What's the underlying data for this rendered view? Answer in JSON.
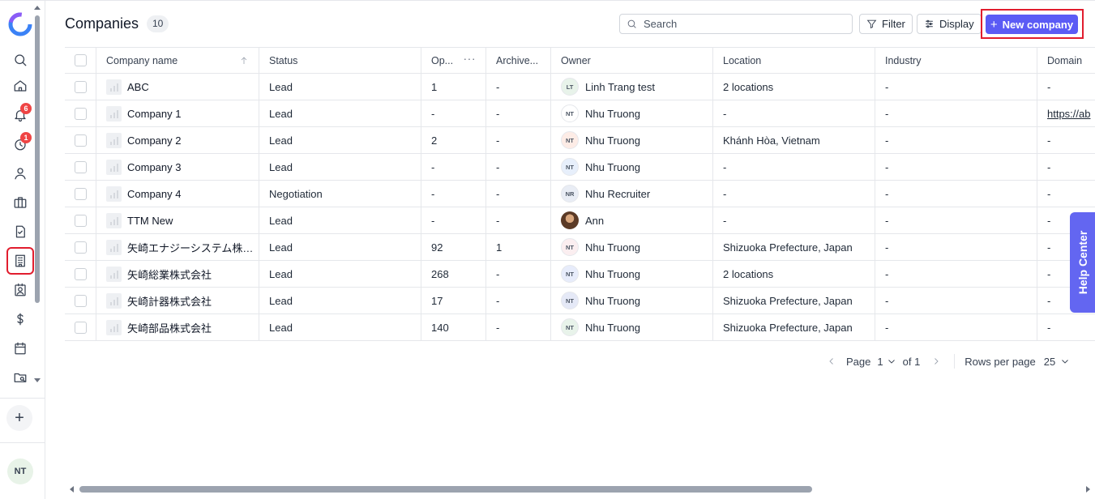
{
  "header": {
    "title": "Companies",
    "count": "10",
    "search_placeholder": "Search",
    "filter_label": "Filter",
    "display_label": "Display",
    "new_label": "New company"
  },
  "sidebar": {
    "badges": {
      "notifications": "6",
      "activity": "1"
    },
    "avatar": "NT",
    "icons": [
      "search-icon",
      "home-icon",
      "bell-icon",
      "activity-icon",
      "person-icon",
      "briefcase-icon",
      "task-icon",
      "building-icon",
      "contact-icon",
      "dollar-icon",
      "calendar-icon",
      "folder-search-icon",
      "plus-icon"
    ]
  },
  "table": {
    "columns": [
      "Company name",
      "Status",
      "Op...",
      "Archive...",
      "Owner",
      "Location",
      "Industry",
      "Domain"
    ],
    "rows": [
      {
        "name": "ABC",
        "status": "Lead",
        "opp": "1",
        "archived": "-",
        "owner_initials": "LT",
        "owner": "Linh Trang test",
        "location": "2 locations",
        "industry": "-",
        "domain": "-"
      },
      {
        "name": "Company 1",
        "status": "Lead",
        "opp": "-",
        "archived": "-",
        "owner_initials": "NT",
        "owner": "Nhu Truong",
        "location": "-",
        "industry": "-",
        "domain": "https://ab"
      },
      {
        "name": "Company 2",
        "status": "Lead",
        "opp": "2",
        "archived": "-",
        "owner_initials": "NT",
        "owner": "Nhu Truong",
        "location": "Khánh Hòa, Vietnam",
        "industry": "-",
        "domain": "-"
      },
      {
        "name": "Company 3",
        "status": "Lead",
        "opp": "-",
        "archived": "-",
        "owner_initials": "NT",
        "owner": "Nhu Truong",
        "location": "-",
        "industry": "-",
        "domain": "-"
      },
      {
        "name": "Company 4",
        "status": "Negotiation",
        "opp": "-",
        "archived": "-",
        "owner_initials": "NR",
        "owner": "Nhu Recruiter",
        "location": "-",
        "industry": "-",
        "domain": "-"
      },
      {
        "name": "TTM New",
        "status": "Lead",
        "opp": "-",
        "archived": "-",
        "owner_initials": "",
        "owner": "Ann",
        "location": "-",
        "industry": "-",
        "domain": "-"
      },
      {
        "name": "矢崎エナジーシステム株式会社",
        "status": "Lead",
        "opp": "92",
        "archived": "1",
        "owner_initials": "NT",
        "owner": "Nhu Truong",
        "location": "Shizuoka Prefecture, Japan",
        "industry": "-",
        "domain": "-"
      },
      {
        "name": "矢崎総業株式会社",
        "status": "Lead",
        "opp": "268",
        "archived": "-",
        "owner_initials": "NT",
        "owner": "Nhu Truong",
        "location": "2 locations",
        "industry": "-",
        "domain": "-"
      },
      {
        "name": "矢崎計器株式会社",
        "status": "Lead",
        "opp": "17",
        "archived": "-",
        "owner_initials": "NT",
        "owner": "Nhu Truong",
        "location": "Shizuoka Prefecture, Japan",
        "industry": "-",
        "domain": "-"
      },
      {
        "name": "矢崎部品株式会社",
        "status": "Lead",
        "opp": "140",
        "archived": "-",
        "owner_initials": "NT",
        "owner": "Nhu Truong",
        "location": "Shizuoka Prefecture, Japan",
        "industry": "-",
        "domain": "-"
      }
    ]
  },
  "pager": {
    "page_label": "Page",
    "page_value": "1",
    "of_label": "of 1",
    "rows_label": "Rows per page",
    "rows_value": "25"
  },
  "help": {
    "label": "Help Center"
  },
  "colors": {
    "accent": "#5b5bf5",
    "highlight": "#e11d2e",
    "help": "#6366f1",
    "badge": "#ef4444"
  }
}
